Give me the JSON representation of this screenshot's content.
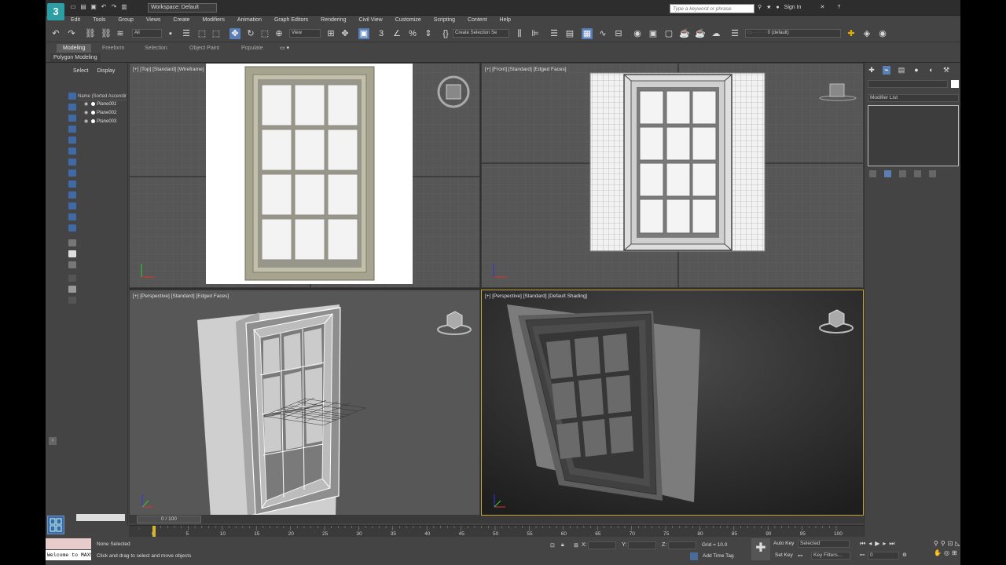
{
  "app": {
    "logo": "3",
    "workspace": "Workspace: Default",
    "search_placeholder": "Type a keyword or phrase",
    "sign_in": "Sign In",
    "help": "?"
  },
  "menu": [
    "Edit",
    "Tools",
    "Group",
    "Views",
    "Create",
    "Modifiers",
    "Animation",
    "Graph Editors",
    "Rendering",
    "Civil View",
    "Customize",
    "Scripting",
    "Content",
    "Help"
  ],
  "toolbar": {
    "filter": "All",
    "ref_coord": "View",
    "selection_set": "Create Selection Se",
    "layer": "0 (default)"
  },
  "ribbon": {
    "tabs": [
      "Modeling",
      "Freeform",
      "Selection",
      "Object Paint",
      "Populate"
    ],
    "active_tab": "Modeling",
    "panel": "Polygon Modeling"
  },
  "explorer": {
    "tabs": [
      "Select",
      "Display"
    ],
    "column_header": "Name (Sorted Ascending)",
    "items": [
      "Plane001",
      "Plane002",
      "Plane003"
    ]
  },
  "viewports": {
    "top": "[+] [Top] [Standard] [Wireframe]",
    "front": "[+] [Front] [Standard] [Edged Faces]",
    "persp_left": "[+] [Perspective] [Standard] [Edged Faces]",
    "persp_right": "[+] [Perspective] [Standard] [Default Shading]"
  },
  "command_panel": {
    "modifier_list": "Modifier List"
  },
  "timeline": {
    "slider": "0 / 100",
    "ticks": [
      "0",
      "5",
      "10",
      "15",
      "20",
      "25",
      "30",
      "35",
      "40",
      "45",
      "50",
      "55",
      "60",
      "65",
      "70",
      "75",
      "80",
      "85",
      "90",
      "95",
      "100"
    ]
  },
  "status": {
    "selection": "None Selected",
    "prompt": "Click and drag to select and move objects",
    "welcome": "Welcome to MAXScript.",
    "x_label": "X:",
    "y_label": "Y:",
    "z_label": "Z:",
    "grid": "Grid = 10.0",
    "add_time_tag": "Add Time Tag",
    "auto_key": "Auto Key",
    "set_key": "Set Key",
    "selected": "Selected",
    "key_filters": "Key Filters...",
    "frame": "0"
  },
  "colors": {
    "active_viewport_border": "#c7a633",
    "active_tool": "#5b7fb5",
    "viewport_bg": "#565656",
    "ui_bg": "#444444"
  }
}
